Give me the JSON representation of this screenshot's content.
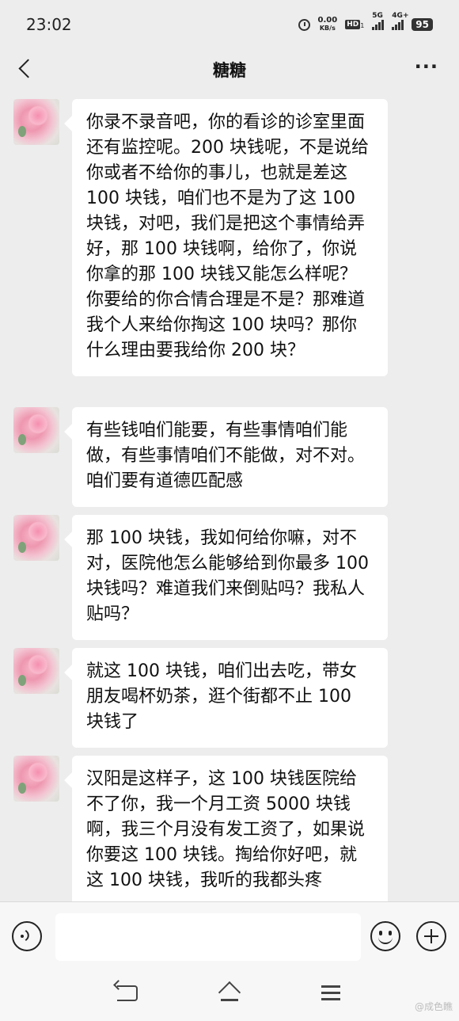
{
  "status_bar": {
    "time": "23:02",
    "net_speed_value": "0.00",
    "net_speed_unit": "KB/s",
    "hd_label": "HD",
    "hd_sub": "1",
    "signal1_label": "5G",
    "signal2_label": "4G+",
    "battery": "95"
  },
  "header": {
    "title": "糖糖",
    "more": "···"
  },
  "messages": [
    {
      "text": "你录不录音吧，你的看诊的诊室里面还有监控呢。200 块钱呢，不是说给你或者不给你的事儿，也就是差这 100 块钱，咱们也不是为了这 100 块钱，对吧，我们是把这个事情给弄好，那 100 块钱啊，给你了，你说你拿的那 100 块钱又能怎么样呢？你要给的你合情合理是不是？那难道我个人来给你掏这 100 块吗？那你什么理由要我给你 200 块？"
    },
    {
      "text": "有些钱咱们能要，有些事情咱们能做，有些事情咱们不能做，对不对。咱们要有道德匹配感"
    },
    {
      "text": "那 100 块钱，我如何给你嘛，对不对，医院他怎么能够给到你最多 100 块钱吗？难道我们来倒贴吗？我私人贴吗？"
    },
    {
      "text": "就这 100 块钱，咱们出去吃，带女朋友喝杯奶茶，逛个街都不止 100 块钱了"
    },
    {
      "text": "汉阳是这样子，这 100 块钱医院给不了你，我一个月工资 5000 块钱啊，我三个月没有发工资了，如果说你要这 100 块钱。掏给你好吧，就这 100 块钱，我听的我都头疼"
    }
  ],
  "input_bar": {
    "placeholder": ""
  },
  "watermark": "@成色瞧"
}
